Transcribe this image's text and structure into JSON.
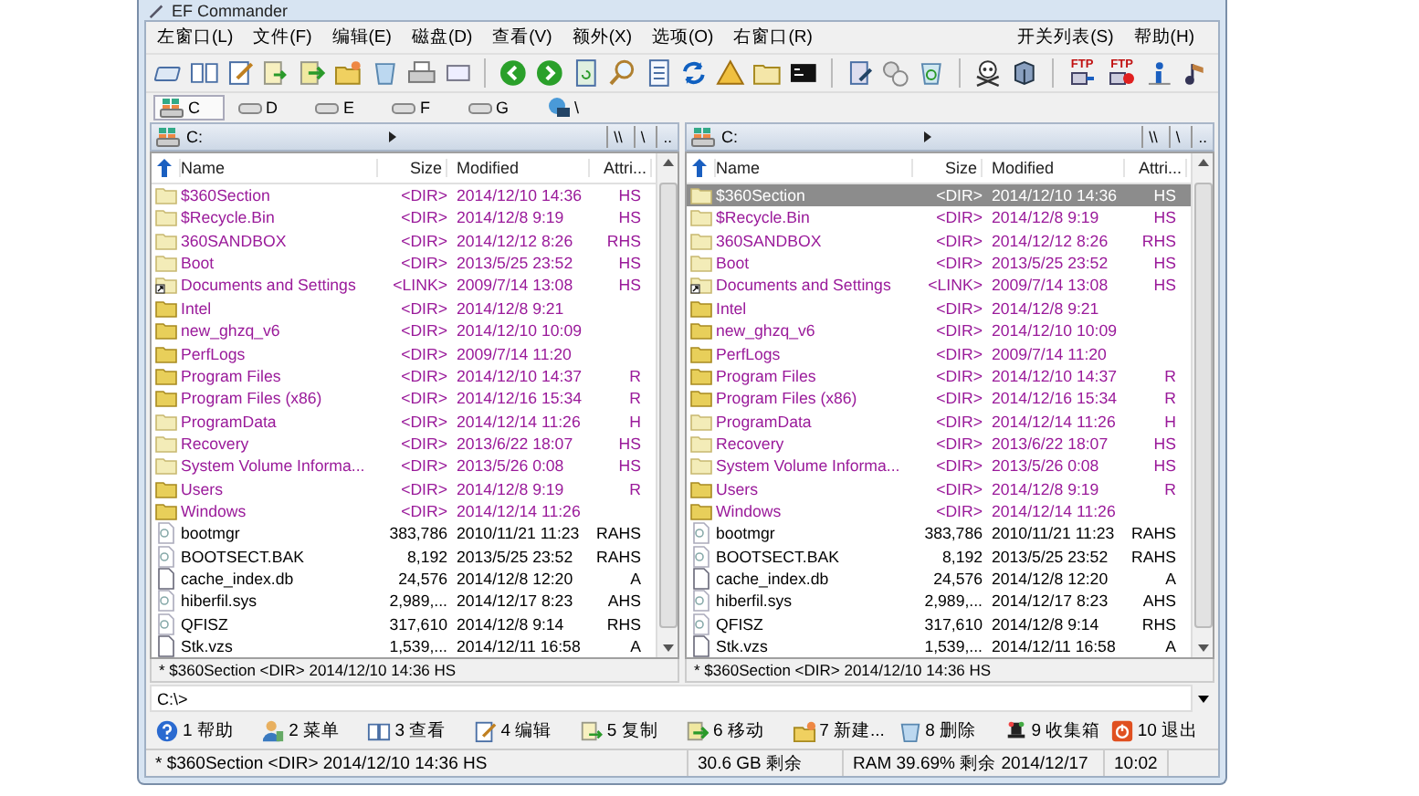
{
  "window": {
    "title": "EF Commander"
  },
  "menu": {
    "left": [
      "左窗口(L)",
      "文件(F)",
      "编辑(E)",
      "磁盘(D)",
      "查看(V)",
      "额外(X)",
      "选项(O)",
      "右窗口(R)"
    ],
    "right": [
      "开关列表(S)",
      "帮助(H)"
    ]
  },
  "toolbar": {
    "ftp_labels": [
      "FTP",
      "FTP"
    ]
  },
  "drives": [
    {
      "label": "C",
      "selected": true,
      "kind": "system"
    },
    {
      "label": "D",
      "selected": false,
      "kind": "disk"
    },
    {
      "label": "E",
      "selected": false,
      "kind": "disk"
    },
    {
      "label": "F",
      "selected": false,
      "kind": "disk"
    },
    {
      "label": "G",
      "selected": false,
      "kind": "disk"
    },
    {
      "label": "\\",
      "selected": false,
      "kind": "network"
    }
  ],
  "panels": [
    {
      "path": "C:",
      "nav": [
        "\\\\",
        "\\",
        ".."
      ],
      "columns": [
        "Name",
        "Size",
        "Modified",
        "Attri..."
      ],
      "status": "* $360Section    <DIR>  2014/12/10  14:36  HS",
      "rows": [
        {
          "kind": "folder",
          "hidden": true,
          "selected": false,
          "name": "$360Section",
          "size": "<DIR>",
          "modified": "2014/12/10  14:36",
          "attr": "HS"
        },
        {
          "kind": "folder",
          "hidden": true,
          "selected": false,
          "name": "$Recycle.Bin",
          "size": "<DIR>",
          "modified": "2014/12/8  9:19",
          "attr": "HS"
        },
        {
          "kind": "folder",
          "hidden": true,
          "selected": false,
          "name": "360SANDBOX",
          "size": "<DIR>",
          "modified": "2014/12/12  8:26",
          "attr": "RHS"
        },
        {
          "kind": "folder",
          "hidden": true,
          "selected": false,
          "name": "Boot",
          "size": "<DIR>",
          "modified": "2013/5/25  23:52",
          "attr": "HS"
        },
        {
          "kind": "link",
          "hidden": true,
          "selected": false,
          "name": "Documents and Settings",
          "size": "<LINK>",
          "modified": "2009/7/14  13:08",
          "attr": "HS"
        },
        {
          "kind": "folder",
          "hidden": false,
          "selected": false,
          "name": "Intel",
          "size": "<DIR>",
          "modified": "2014/12/8  9:21",
          "attr": ""
        },
        {
          "kind": "folder",
          "hidden": false,
          "selected": false,
          "name": "new_ghzq_v6",
          "size": "<DIR>",
          "modified": "2014/12/10  10:09",
          "attr": ""
        },
        {
          "kind": "folder",
          "hidden": false,
          "selected": false,
          "name": "PerfLogs",
          "size": "<DIR>",
          "modified": "2009/7/14  11:20",
          "attr": ""
        },
        {
          "kind": "folder",
          "hidden": false,
          "selected": false,
          "name": "Program Files",
          "size": "<DIR>",
          "modified": "2014/12/10  14:37",
          "attr": "R"
        },
        {
          "kind": "folder",
          "hidden": false,
          "selected": false,
          "name": "Program Files (x86)",
          "size": "<DIR>",
          "modified": "2014/12/16  15:34",
          "attr": "R"
        },
        {
          "kind": "folder",
          "hidden": true,
          "selected": false,
          "name": "ProgramData",
          "size": "<DIR>",
          "modified": "2014/12/14  11:26",
          "attr": "H"
        },
        {
          "kind": "folder",
          "hidden": true,
          "selected": false,
          "name": "Recovery",
          "size": "<DIR>",
          "modified": "2013/6/22  18:07",
          "attr": "HS"
        },
        {
          "kind": "folder",
          "hidden": true,
          "selected": false,
          "name": "System Volume Informa...",
          "size": "<DIR>",
          "modified": "2013/5/26  0:08",
          "attr": "HS"
        },
        {
          "kind": "folder",
          "hidden": false,
          "selected": false,
          "name": "Users",
          "size": "<DIR>",
          "modified": "2014/12/8  9:19",
          "attr": "R"
        },
        {
          "kind": "folder",
          "hidden": false,
          "selected": false,
          "name": "Windows",
          "size": "<DIR>",
          "modified": "2014/12/14  11:26",
          "attr": ""
        },
        {
          "kind": "file",
          "hidden": true,
          "selected": false,
          "name": "bootmgr",
          "size": "383,786",
          "modified": "2010/11/21  11:23",
          "attr": "RAHS"
        },
        {
          "kind": "file",
          "hidden": true,
          "selected": false,
          "name": "BOOTSECT.BAK",
          "size": "8,192",
          "modified": "2013/5/25  23:52",
          "attr": "RAHS"
        },
        {
          "kind": "file",
          "hidden": false,
          "selected": false,
          "name": "cache_index.db",
          "size": "24,576",
          "modified": "2014/12/8  12:20",
          "attr": "A"
        },
        {
          "kind": "file",
          "hidden": true,
          "selected": false,
          "name": "hiberfil.sys",
          "size": "2,989,...",
          "modified": "2014/12/17  8:23",
          "attr": "AHS"
        },
        {
          "kind": "file",
          "hidden": true,
          "selected": false,
          "name": "QFISZ",
          "size": "317,610",
          "modified": "2014/12/8  9:14",
          "attr": "RHS"
        },
        {
          "kind": "file",
          "hidden": false,
          "selected": false,
          "name": "Stk.vzs",
          "size": "1,539,...",
          "modified": "2014/12/11  16:58",
          "attr": "A"
        }
      ]
    },
    {
      "path": "C:",
      "nav": [
        "\\\\",
        "\\",
        ".."
      ],
      "columns": [
        "Name",
        "Size",
        "Modified",
        "Attri..."
      ],
      "status": "* $360Section    <DIR>  2014/12/10  14:36  HS",
      "rows": [
        {
          "kind": "folder",
          "hidden": true,
          "selected": true,
          "name": "$360Section",
          "size": "<DIR>",
          "modified": "2014/12/10  14:36",
          "attr": "HS"
        },
        {
          "kind": "folder",
          "hidden": true,
          "selected": false,
          "name": "$Recycle.Bin",
          "size": "<DIR>",
          "modified": "2014/12/8  9:19",
          "attr": "HS"
        },
        {
          "kind": "folder",
          "hidden": true,
          "selected": false,
          "name": "360SANDBOX",
          "size": "<DIR>",
          "modified": "2014/12/12  8:26",
          "attr": "RHS"
        },
        {
          "kind": "folder",
          "hidden": true,
          "selected": false,
          "name": "Boot",
          "size": "<DIR>",
          "modified": "2013/5/25  23:52",
          "attr": "HS"
        },
        {
          "kind": "link",
          "hidden": true,
          "selected": false,
          "name": "Documents and Settings",
          "size": "<LINK>",
          "modified": "2009/7/14  13:08",
          "attr": "HS"
        },
        {
          "kind": "folder",
          "hidden": false,
          "selected": false,
          "name": "Intel",
          "size": "<DIR>",
          "modified": "2014/12/8  9:21",
          "attr": ""
        },
        {
          "kind": "folder",
          "hidden": false,
          "selected": false,
          "name": "new_ghzq_v6",
          "size": "<DIR>",
          "modified": "2014/12/10  10:09",
          "attr": ""
        },
        {
          "kind": "folder",
          "hidden": false,
          "selected": false,
          "name": "PerfLogs",
          "size": "<DIR>",
          "modified": "2009/7/14  11:20",
          "attr": ""
        },
        {
          "kind": "folder",
          "hidden": false,
          "selected": false,
          "name": "Program Files",
          "size": "<DIR>",
          "modified": "2014/12/10  14:37",
          "attr": "R"
        },
        {
          "kind": "folder",
          "hidden": false,
          "selected": false,
          "name": "Program Files (x86)",
          "size": "<DIR>",
          "modified": "2014/12/16  15:34",
          "attr": "R"
        },
        {
          "kind": "folder",
          "hidden": true,
          "selected": false,
          "name": "ProgramData",
          "size": "<DIR>",
          "modified": "2014/12/14  11:26",
          "attr": "H"
        },
        {
          "kind": "folder",
          "hidden": true,
          "selected": false,
          "name": "Recovery",
          "size": "<DIR>",
          "modified": "2013/6/22  18:07",
          "attr": "HS"
        },
        {
          "kind": "folder",
          "hidden": true,
          "selected": false,
          "name": "System Volume Informa...",
          "size": "<DIR>",
          "modified": "2013/5/26  0:08",
          "attr": "HS"
        },
        {
          "kind": "folder",
          "hidden": false,
          "selected": false,
          "name": "Users",
          "size": "<DIR>",
          "modified": "2014/12/8  9:19",
          "attr": "R"
        },
        {
          "kind": "folder",
          "hidden": false,
          "selected": false,
          "name": "Windows",
          "size": "<DIR>",
          "modified": "2014/12/14  11:26",
          "attr": ""
        },
        {
          "kind": "file",
          "hidden": true,
          "selected": false,
          "name": "bootmgr",
          "size": "383,786",
          "modified": "2010/11/21  11:23",
          "attr": "RAHS"
        },
        {
          "kind": "file",
          "hidden": true,
          "selected": false,
          "name": "BOOTSECT.BAK",
          "size": "8,192",
          "modified": "2013/5/25  23:52",
          "attr": "RAHS"
        },
        {
          "kind": "file",
          "hidden": false,
          "selected": false,
          "name": "cache_index.db",
          "size": "24,576",
          "modified": "2014/12/8  12:20",
          "attr": "A"
        },
        {
          "kind": "file",
          "hidden": true,
          "selected": false,
          "name": "hiberfil.sys",
          "size": "2,989,...",
          "modified": "2014/12/17  8:23",
          "attr": "AHS"
        },
        {
          "kind": "file",
          "hidden": true,
          "selected": false,
          "name": "QFISZ",
          "size": "317,610",
          "modified": "2014/12/8  9:14",
          "attr": "RHS"
        },
        {
          "kind": "file",
          "hidden": false,
          "selected": false,
          "name": "Stk.vzs",
          "size": "1,539,...",
          "modified": "2014/12/11  16:58",
          "attr": "A"
        }
      ]
    }
  ],
  "command_line": {
    "value": "C:\\>"
  },
  "function_keys": [
    {
      "number": "1",
      "label": "帮助",
      "kind": "help"
    },
    {
      "number": "2",
      "label": "菜单",
      "kind": "menu"
    },
    {
      "number": "3",
      "label": "查看",
      "kind": "view"
    },
    {
      "number": "4",
      "label": "编辑",
      "kind": "edit"
    },
    {
      "number": "5",
      "label": "复制",
      "kind": "copy"
    },
    {
      "number": "6",
      "label": "移动",
      "kind": "move"
    },
    {
      "number": "7",
      "label": "新建...",
      "kind": "new"
    },
    {
      "number": "8",
      "label": "删除",
      "kind": "delete"
    },
    {
      "number": "9",
      "label": "收集箱",
      "kind": "collect"
    },
    {
      "number": "10",
      "label": "退出",
      "kind": "exit"
    }
  ],
  "status_bar": {
    "selection": "* $360Section    <DIR>  2014/12/10  14:36  HS",
    "free": "30.6 GB 剩余",
    "memory": "RAM 39.69% 剩余 2014/12/17",
    "time": "10:02"
  }
}
